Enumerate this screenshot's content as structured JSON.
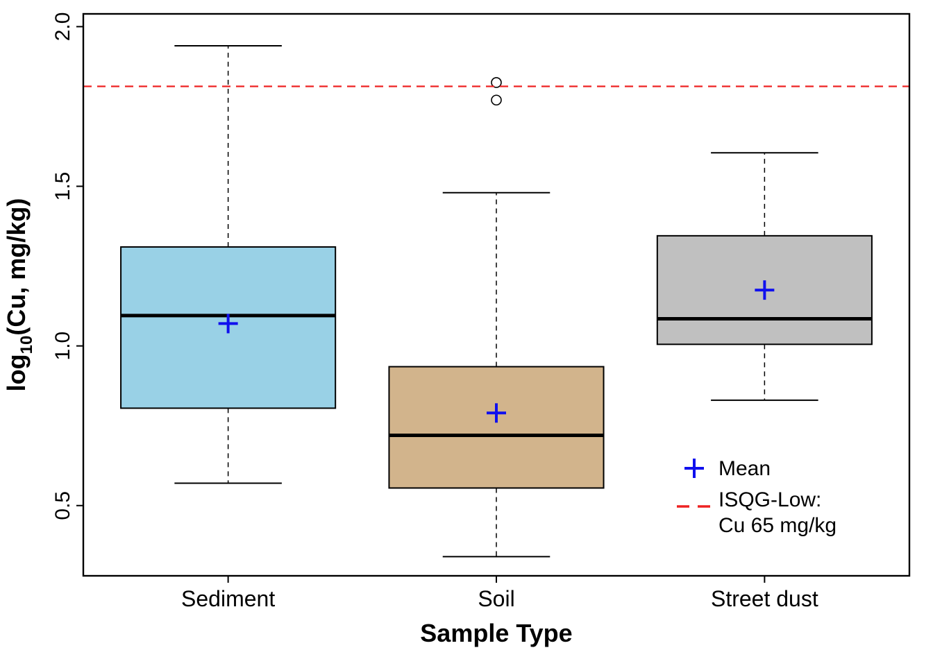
{
  "chart_data": {
    "type": "boxplot",
    "xlabel": "Sample Type",
    "ylabel_parts": {
      "pre": "log",
      "sub": "10",
      "post": "(Cu, mg/kg)"
    },
    "categories": [
      "Sediment",
      "Soil",
      "Street dust"
    ],
    "y_ticks": [
      0.5,
      1.0,
      1.5,
      2.0
    ],
    "y_tick_labels": [
      "0.5",
      "1.0",
      "1.5",
      "2.0"
    ],
    "ylim": [
      0.28,
      2.04
    ],
    "hline": {
      "value": 1.813,
      "color": "#ee2222"
    },
    "boxes": [
      {
        "category": "Sediment",
        "lower_whisker": 0.57,
        "q1": 0.805,
        "median": 1.095,
        "q3": 1.31,
        "upper_whisker": 1.94,
        "mean": 1.07,
        "outliers": [],
        "fill": "#99d1e6"
      },
      {
        "category": "Soil",
        "lower_whisker": 0.34,
        "q1": 0.555,
        "median": 0.72,
        "q3": 0.935,
        "upper_whisker": 1.48,
        "mean": 0.79,
        "outliers": [
          1.77,
          1.825
        ],
        "fill": "#d2b48c"
      },
      {
        "category": "Street dust",
        "lower_whisker": 0.83,
        "q1": 1.005,
        "median": 1.085,
        "q3": 1.345,
        "upper_whisker": 1.605,
        "mean": 1.175,
        "outliers": [],
        "fill": "#c0c0c0"
      }
    ],
    "legend": {
      "mean_label": "Mean",
      "hline_label_1": "ISQG-Low:",
      "hline_label_2": "Cu 65 mg/kg"
    }
  }
}
